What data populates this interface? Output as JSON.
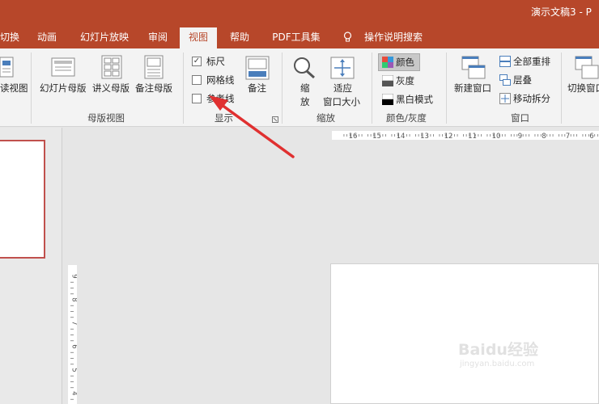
{
  "window": {
    "title": "演示文稿3 - P"
  },
  "tabs": [
    {
      "label": "切换"
    },
    {
      "label": "动画"
    },
    {
      "label": "幻灯片放映"
    },
    {
      "label": "审阅"
    },
    {
      "label": "视图",
      "active": true
    },
    {
      "label": "帮助"
    },
    {
      "label": "PDF工具集"
    },
    {
      "label": "操作说明搜索"
    }
  ],
  "ribbon": {
    "presentation_views": {
      "partial_label": "读视图"
    },
    "master_views": {
      "group_label": "母版视图",
      "slide_master": "幻灯片母版",
      "handout_master": "讲义母版",
      "notes_master": "备注母版"
    },
    "show": {
      "group_label": "显示",
      "ruler": {
        "label": "标尺",
        "checked": true
      },
      "gridlines": {
        "label": "网格线",
        "checked": false
      },
      "guides": {
        "label": "参考线",
        "checked": false
      },
      "notes": "备注"
    },
    "zoom": {
      "group_label": "缩放",
      "zoom_line1": "缩",
      "zoom_line2": "放",
      "fit_line1": "适应",
      "fit_line2": "窗口大小"
    },
    "color": {
      "group_label": "颜色/灰度",
      "color": "颜色",
      "grayscale": "灰度",
      "black_white": "黑白模式"
    },
    "window": {
      "group_label": "窗口",
      "new_window": "新建窗口",
      "arrange_all": "全部重排",
      "cascade": "层叠",
      "move_split": "移动拆分"
    },
    "switch_windows": {
      "partial_label": "切换窗口"
    }
  },
  "rulers": {
    "horizontal_ticks": [
      "16",
      "15",
      "14",
      "13",
      "12",
      "11",
      "10",
      "9",
      "8",
      "7",
      "6"
    ],
    "vertical_ticks": [
      "9",
      "8",
      "7",
      "6",
      "5",
      "4"
    ]
  },
  "watermark": {
    "logo": "Baidu经验",
    "url": "jingyan.baidu.com"
  },
  "colors": {
    "accent": "#b7472a",
    "ribbon_bg": "#f3f3f3",
    "arrow": "#e03030"
  }
}
